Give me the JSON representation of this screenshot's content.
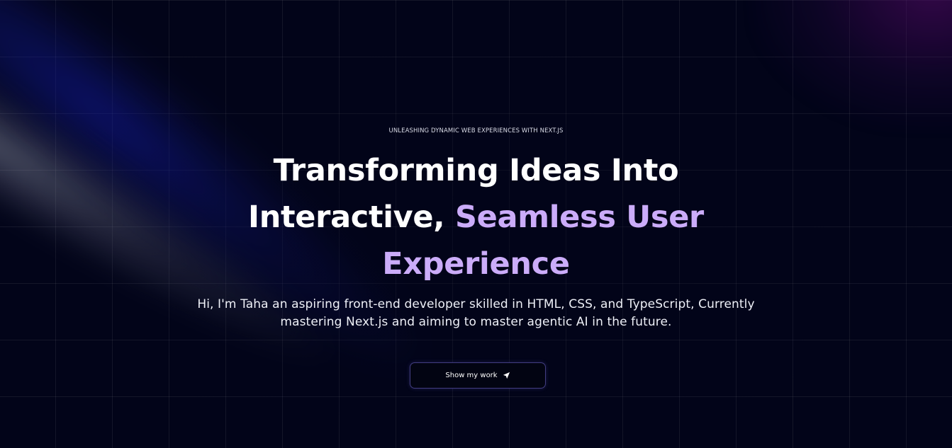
{
  "hero": {
    "eyebrow": "UNLEASHING DYNAMIC WEB EXPERIENCES WITH NEXT.JS",
    "headline_part1": "Transforming Ideas Into Interactive,",
    "headline_accent": "Seamless User Experience",
    "intro": "Hi, I'm Taha an aspiring front-end developer skilled in HTML, CSS, and TypeScript, Currently mastering Next.js and aiming to master agentic AI in the future.",
    "cta_label": "Show my work",
    "cta_icon": "send-arrow-icon"
  },
  "colors": {
    "background": "#020419",
    "accent": "#cbacf9",
    "text": "#ffffff"
  }
}
